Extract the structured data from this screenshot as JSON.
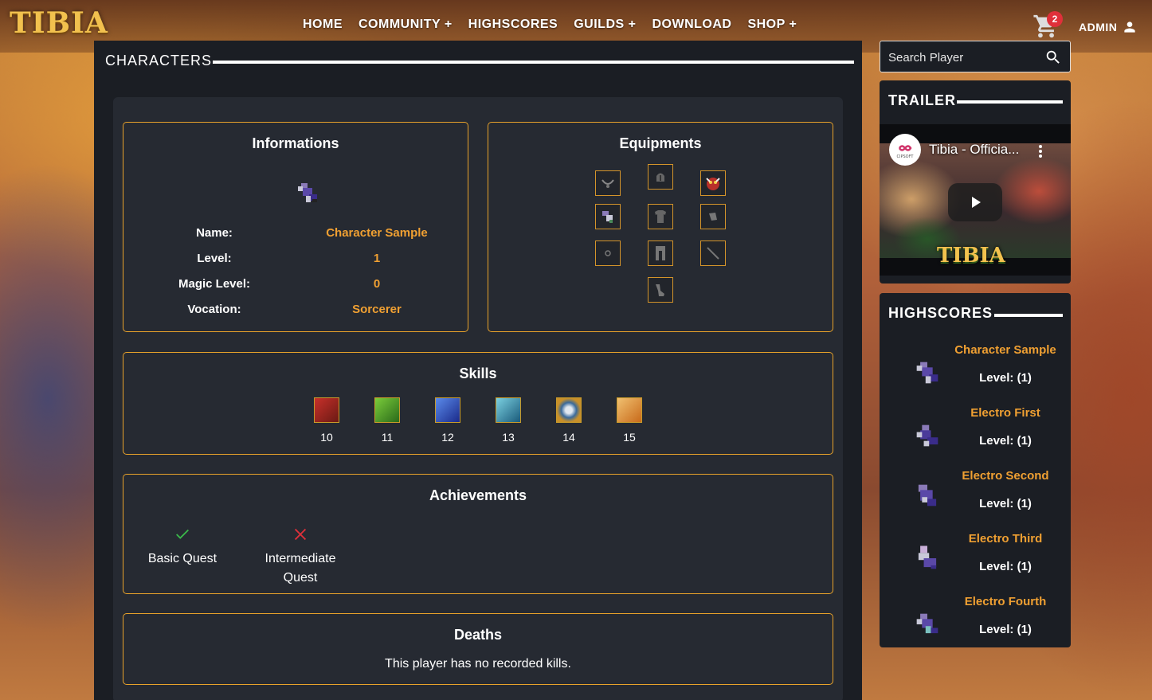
{
  "brand": {
    "logo_text": "TIBIA"
  },
  "nav": {
    "items": [
      {
        "label": "HOME"
      },
      {
        "label": "COMMUNITY +"
      },
      {
        "label": "HIGHSCORES"
      },
      {
        "label": "GUILDS +"
      },
      {
        "label": "DOWNLOAD"
      },
      {
        "label": "SHOP +"
      }
    ],
    "cart_count": "2",
    "user_label": "ADMIN"
  },
  "main": {
    "section_title": "CHARACTERS",
    "informations": {
      "title": "Informations",
      "rows": [
        {
          "label": "Name:",
          "value": "Character Sample"
        },
        {
          "label": "Level:",
          "value": "1"
        },
        {
          "label": "Magic Level:",
          "value": "0"
        },
        {
          "label": "Vocation:",
          "value": "Sorcerer"
        }
      ]
    },
    "equipments": {
      "title": "Equipments",
      "slots": [
        "amulet",
        "helmet",
        "backpack",
        "weapon",
        "armor",
        "shield",
        "ring",
        "legs",
        "ammo",
        "boots"
      ]
    },
    "skills": {
      "title": "Skills",
      "items": [
        {
          "icon": "fist-skill-icon",
          "value": "10"
        },
        {
          "icon": "club-skill-icon",
          "value": "11"
        },
        {
          "icon": "sword-skill-icon",
          "value": "12"
        },
        {
          "icon": "axe-skill-icon",
          "value": "13"
        },
        {
          "icon": "distance-skill-icon",
          "value": "14"
        },
        {
          "icon": "shielding-skill-icon",
          "value": "15"
        }
      ]
    },
    "achievements": {
      "title": "Achievements",
      "items": [
        {
          "label": "Basic Quest",
          "done": true
        },
        {
          "label_line1": "Intermediate",
          "label_line2": "Quest",
          "done": false
        }
      ]
    },
    "deaths": {
      "title": "Deaths",
      "message": "This player has no recorded kills."
    }
  },
  "sidebar": {
    "search_placeholder": "Search Player",
    "trailer": {
      "title": "TRAILER",
      "video_title": "Tibia - Officia...",
      "channel": "CIPSOFT",
      "video_logo_text": "TIBIA"
    },
    "highscores": {
      "title": "HIGHSCORES",
      "items": [
        {
          "name": "Character Sample",
          "level": "Level: (1)"
        },
        {
          "name": "Electro First",
          "level": "Level: (1)"
        },
        {
          "name": "Electro Second",
          "level": "Level: (1)"
        },
        {
          "name": "Electro Third",
          "level": "Level: (1)"
        },
        {
          "name": "Electro Fourth",
          "level": "Level: (1)"
        }
      ]
    }
  },
  "colors": {
    "accent": "#f0a032",
    "card_border": "#e8a22a",
    "panel_bg": "#1b1e24",
    "box_bg": "#262a32"
  }
}
